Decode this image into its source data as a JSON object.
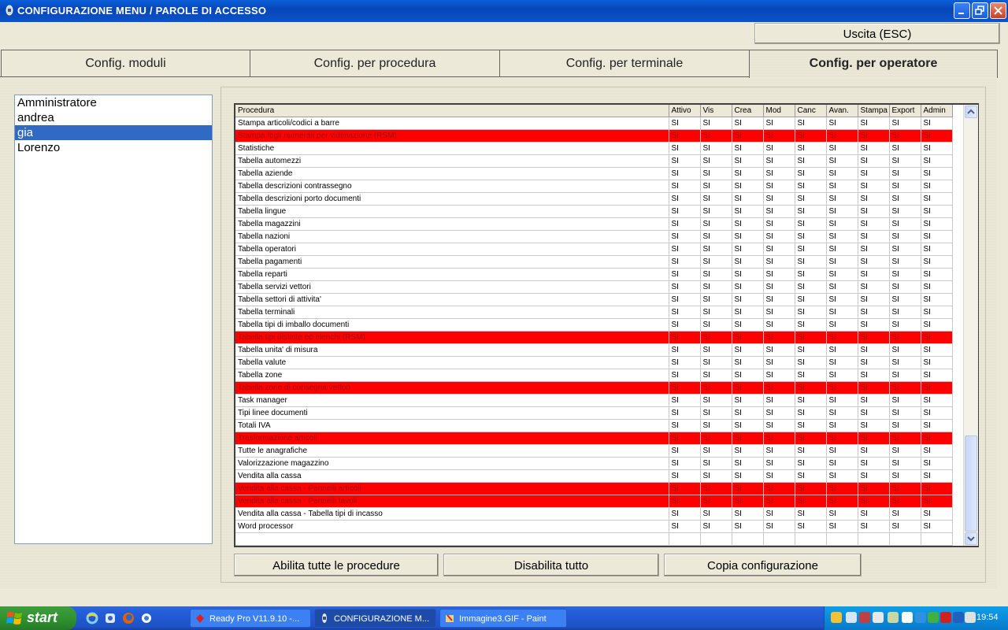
{
  "window": {
    "title": "CONFIGURAZIONE MENU / PAROLE DI ACCESSO"
  },
  "exit_button": "Uscita (ESC)",
  "tabs": [
    {
      "label": "Config. moduli"
    },
    {
      "label": "Config. per procedura"
    },
    {
      "label": "Config. per terminale"
    },
    {
      "label": "Config. per operatore",
      "active": true
    }
  ],
  "users": [
    "Amministratore",
    "andrea",
    "gia",
    "Lorenzo"
  ],
  "selected_user": "gia",
  "grid": {
    "columns": [
      "Procedura",
      "Attivo",
      "Vis",
      "Crea",
      "Mod",
      "Canc",
      "Avan.",
      "Stampa",
      "Export",
      "Admin"
    ],
    "cell_value": "SI",
    "rows": [
      {
        "name": "Stampa articoli/codici a barre",
        "red": false
      },
      {
        "name": "Stampa fogli numerati per vidimazione (RSM)",
        "red": true
      },
      {
        "name": "Statistiche",
        "red": false
      },
      {
        "name": "Tabella automezzi",
        "red": false
      },
      {
        "name": "Tabella aziende",
        "red": false
      },
      {
        "name": "Tabella descrizioni contrassegno",
        "red": false
      },
      {
        "name": "Tabella descrizioni porto documenti",
        "red": false
      },
      {
        "name": "Tabella lingue",
        "red": false
      },
      {
        "name": "Tabella magazzini",
        "red": false
      },
      {
        "name": "Tabella nazioni",
        "red": false
      },
      {
        "name": "Tabella operatori",
        "red": false
      },
      {
        "name": "Tabella pagamenti",
        "red": false
      },
      {
        "name": "Tabella reparti",
        "red": false
      },
      {
        "name": "Tabella servizi vettori",
        "red": false
      },
      {
        "name": "Tabella settori di attivita'",
        "red": false
      },
      {
        "name": "Tabella terminali",
        "red": false
      },
      {
        "name": "Tabella tipi di imballo documenti",
        "red": false
      },
      {
        "name": "Tabella tipi distinte ed elenchi (RSM)",
        "red": true
      },
      {
        "name": "Tabella unita' di misura",
        "red": false
      },
      {
        "name": "Tabella valute",
        "red": false
      },
      {
        "name": "Tabella zone",
        "red": false
      },
      {
        "name": "Tabella zone di consegna vettori",
        "red": true
      },
      {
        "name": "Task manager",
        "red": false
      },
      {
        "name": "Tipi linee documenti",
        "red": false
      },
      {
        "name": "Totali IVA",
        "red": false
      },
      {
        "name": "Trasformazione articoli",
        "red": true
      },
      {
        "name": "Tutte le anagrafiche",
        "red": false
      },
      {
        "name": "Valorizzazione magazzino",
        "red": false
      },
      {
        "name": "Vendita alla cassa",
        "red": false
      },
      {
        "name": "Vendita alla cassa - Pannelli articoli",
        "red": true
      },
      {
        "name": "Vendita alla cassa - Pannelli tavoli",
        "red": true
      },
      {
        "name": "Vendita alla cassa - Tabella tipi di incasso",
        "red": false
      },
      {
        "name": "Word processor",
        "red": false
      }
    ]
  },
  "actions": {
    "enable_all": "Abilita tutte le procedure",
    "disable_all": "Disabilita tutto",
    "copy_config": "Copia configurazione"
  },
  "taskbar": {
    "start": "start",
    "tasks": [
      {
        "label": "Ready Pro V11.9.10 -...",
        "active": false
      },
      {
        "label": "CONFIGURAZIONE M...",
        "active": true
      },
      {
        "label": "Immagine3.GIF - Paint",
        "active": false
      }
    ],
    "clock": "19:54"
  },
  "colors": {
    "highlight_row": "#ff0000",
    "selection": "#316ac5",
    "titlebar": "#0a54c8"
  }
}
